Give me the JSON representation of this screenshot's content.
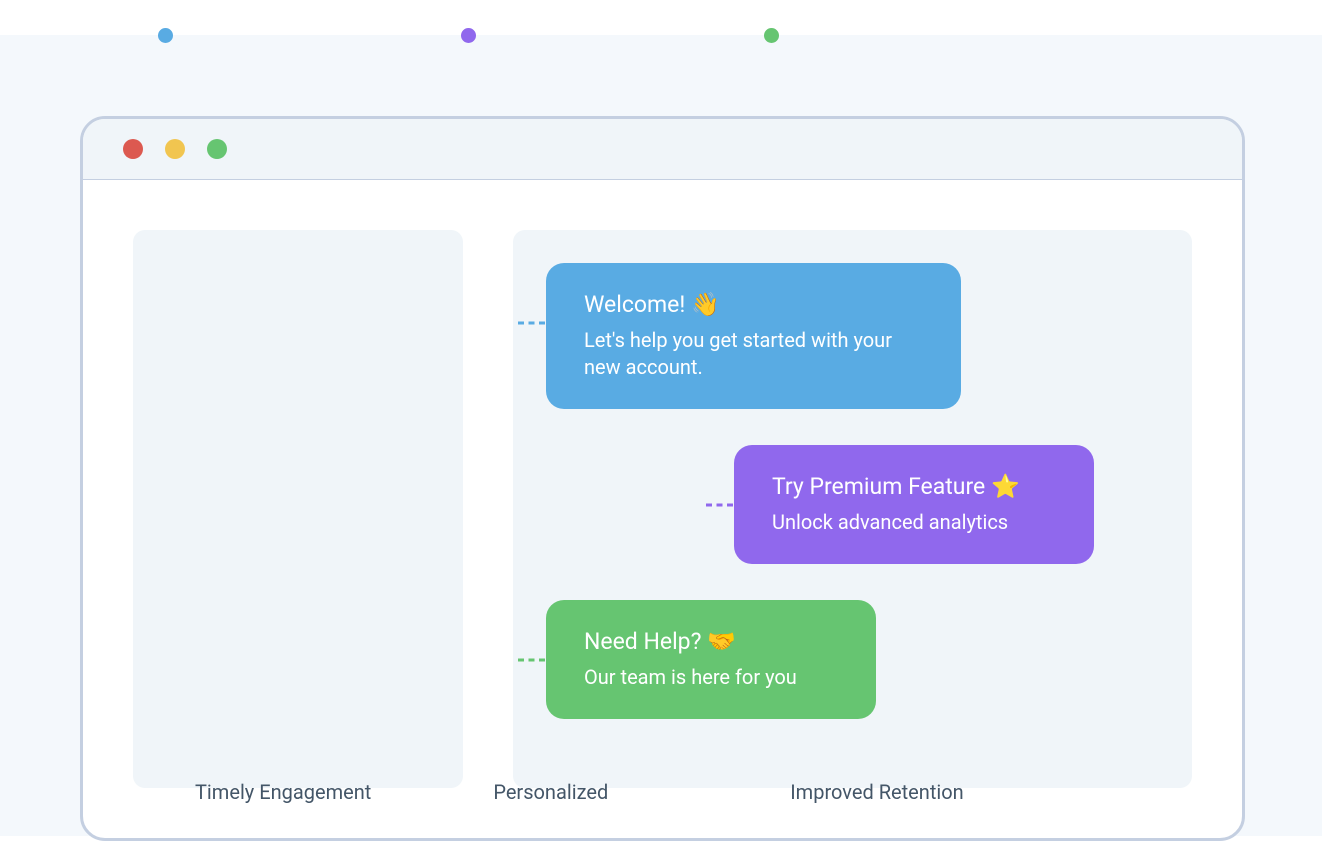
{
  "notifications": {
    "welcome": {
      "title": "Welcome! 👋",
      "subtitle": "Let's help you get started with your new account."
    },
    "premium": {
      "title": "Try Premium Feature ⭐",
      "subtitle": "Unlock advanced analytics"
    },
    "help": {
      "title": "Need Help? 🤝",
      "subtitle": "Our team is here for you"
    }
  },
  "features": {
    "timely": "Timely Engagement",
    "personalized": "Personalized",
    "retention": "Improved Retention"
  },
  "colors": {
    "blue": "#59abe3",
    "purple": "#9068ed",
    "green": "#66c571",
    "red": "#dc5950",
    "yellow": "#f1c550"
  }
}
